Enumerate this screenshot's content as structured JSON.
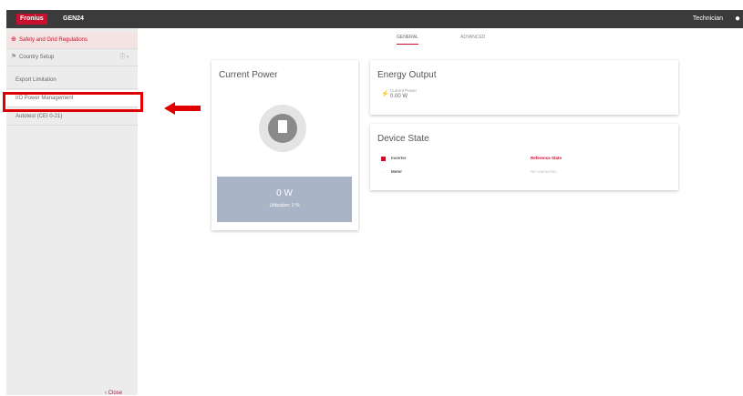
{
  "topbar": {
    "brand": "Fronius",
    "device": "GEN24",
    "user": "Technician",
    "user_icon": "user-icon"
  },
  "sidebar": {
    "items": [
      {
        "label": "Safety and Grid Regulations",
        "icon": "globe-icon"
      },
      {
        "label": "Country Setup",
        "icon": "flag-icon",
        "right": "ⓘ ›"
      },
      {
        "label": "Export Limitation"
      },
      {
        "label": "I/O Power Management"
      },
      {
        "label": "Autotest (CEI 0-21)"
      }
    ],
    "close_label": "‹ Close"
  },
  "tabs": [
    {
      "label": "GENERAL"
    },
    {
      "label": "ADVANCED"
    }
  ],
  "power_card": {
    "title": "Current Power",
    "value": "0 W",
    "utilization": "Utilization: 0 %"
  },
  "energy_card": {
    "title": "Energy Output",
    "label": "Current Power",
    "value": "0.00 W"
  },
  "device_card": {
    "title": "Device State",
    "rows": [
      {
        "label": "Inverter"
      },
      {
        "label": "Meter"
      }
    ],
    "reference_label": "Reference State",
    "status_text": "No connection"
  },
  "colors": {
    "accent": "#c8102e",
    "highlight": "#e00000",
    "topbar": "#3b3b3b"
  }
}
